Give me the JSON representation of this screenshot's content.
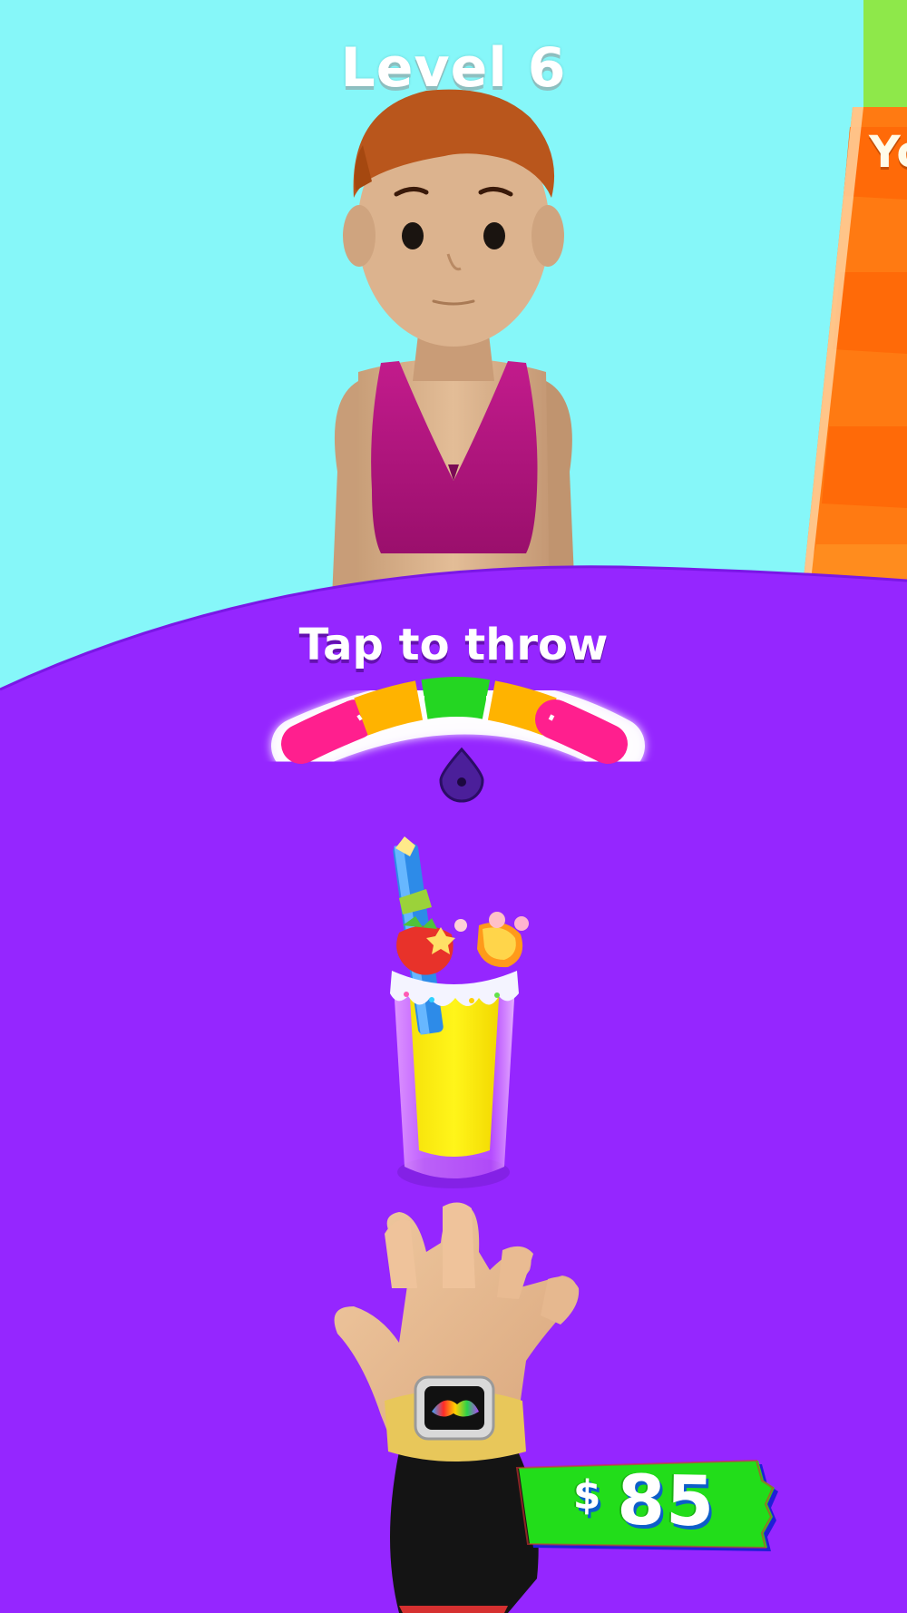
{
  "hud": {
    "level_label": "Level 6",
    "tap_hint": "Tap to throw",
    "side_banner_text": "Yo",
    "money": {
      "currency_symbol": "$",
      "amount": "85"
    }
  },
  "power_meter": {
    "zones": [
      "pink",
      "orange",
      "green",
      "orange",
      "pink"
    ],
    "zone_colors": [
      "#ff1f8e",
      "#ffb300",
      "#24d622",
      "#ffb300",
      "#ff1f8e"
    ],
    "indicator": "drop-pointer"
  },
  "scene": {
    "background_color": "#86f7f9",
    "table_color": "#9526ff",
    "character": "customer-woman",
    "drink": "yellow-cocktail-glass",
    "player_hand": "open-hand-with-watch"
  }
}
